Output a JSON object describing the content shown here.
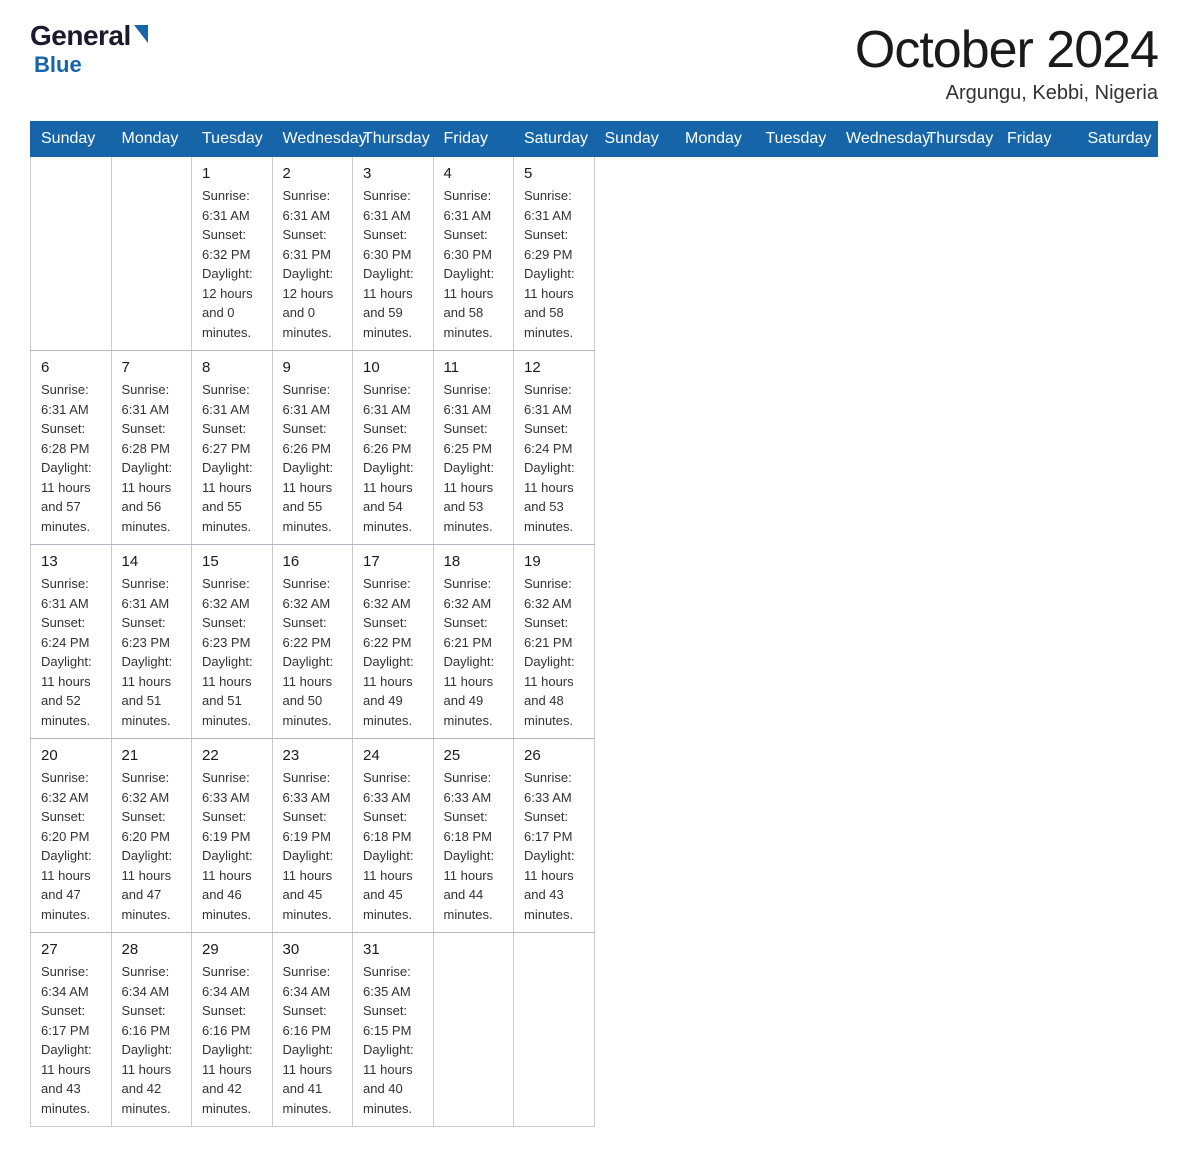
{
  "header": {
    "logo": {
      "general": "General",
      "blue": "Blue"
    },
    "title": "October 2024",
    "location": "Argungu, Kebbi, Nigeria"
  },
  "days_of_week": [
    "Sunday",
    "Monday",
    "Tuesday",
    "Wednesday",
    "Thursday",
    "Friday",
    "Saturday"
  ],
  "weeks": [
    [
      {
        "day": "",
        "info": ""
      },
      {
        "day": "",
        "info": ""
      },
      {
        "day": "1",
        "info": "Sunrise: 6:31 AM\nSunset: 6:32 PM\nDaylight: 12 hours\nand 0 minutes."
      },
      {
        "day": "2",
        "info": "Sunrise: 6:31 AM\nSunset: 6:31 PM\nDaylight: 12 hours\nand 0 minutes."
      },
      {
        "day": "3",
        "info": "Sunrise: 6:31 AM\nSunset: 6:30 PM\nDaylight: 11 hours\nand 59 minutes."
      },
      {
        "day": "4",
        "info": "Sunrise: 6:31 AM\nSunset: 6:30 PM\nDaylight: 11 hours\nand 58 minutes."
      },
      {
        "day": "5",
        "info": "Sunrise: 6:31 AM\nSunset: 6:29 PM\nDaylight: 11 hours\nand 58 minutes."
      }
    ],
    [
      {
        "day": "6",
        "info": "Sunrise: 6:31 AM\nSunset: 6:28 PM\nDaylight: 11 hours\nand 57 minutes."
      },
      {
        "day": "7",
        "info": "Sunrise: 6:31 AM\nSunset: 6:28 PM\nDaylight: 11 hours\nand 56 minutes."
      },
      {
        "day": "8",
        "info": "Sunrise: 6:31 AM\nSunset: 6:27 PM\nDaylight: 11 hours\nand 55 minutes."
      },
      {
        "day": "9",
        "info": "Sunrise: 6:31 AM\nSunset: 6:26 PM\nDaylight: 11 hours\nand 55 minutes."
      },
      {
        "day": "10",
        "info": "Sunrise: 6:31 AM\nSunset: 6:26 PM\nDaylight: 11 hours\nand 54 minutes."
      },
      {
        "day": "11",
        "info": "Sunrise: 6:31 AM\nSunset: 6:25 PM\nDaylight: 11 hours\nand 53 minutes."
      },
      {
        "day": "12",
        "info": "Sunrise: 6:31 AM\nSunset: 6:24 PM\nDaylight: 11 hours\nand 53 minutes."
      }
    ],
    [
      {
        "day": "13",
        "info": "Sunrise: 6:31 AM\nSunset: 6:24 PM\nDaylight: 11 hours\nand 52 minutes."
      },
      {
        "day": "14",
        "info": "Sunrise: 6:31 AM\nSunset: 6:23 PM\nDaylight: 11 hours\nand 51 minutes."
      },
      {
        "day": "15",
        "info": "Sunrise: 6:32 AM\nSunset: 6:23 PM\nDaylight: 11 hours\nand 51 minutes."
      },
      {
        "day": "16",
        "info": "Sunrise: 6:32 AM\nSunset: 6:22 PM\nDaylight: 11 hours\nand 50 minutes."
      },
      {
        "day": "17",
        "info": "Sunrise: 6:32 AM\nSunset: 6:22 PM\nDaylight: 11 hours\nand 49 minutes."
      },
      {
        "day": "18",
        "info": "Sunrise: 6:32 AM\nSunset: 6:21 PM\nDaylight: 11 hours\nand 49 minutes."
      },
      {
        "day": "19",
        "info": "Sunrise: 6:32 AM\nSunset: 6:21 PM\nDaylight: 11 hours\nand 48 minutes."
      }
    ],
    [
      {
        "day": "20",
        "info": "Sunrise: 6:32 AM\nSunset: 6:20 PM\nDaylight: 11 hours\nand 47 minutes."
      },
      {
        "day": "21",
        "info": "Sunrise: 6:32 AM\nSunset: 6:20 PM\nDaylight: 11 hours\nand 47 minutes."
      },
      {
        "day": "22",
        "info": "Sunrise: 6:33 AM\nSunset: 6:19 PM\nDaylight: 11 hours\nand 46 minutes."
      },
      {
        "day": "23",
        "info": "Sunrise: 6:33 AM\nSunset: 6:19 PM\nDaylight: 11 hours\nand 45 minutes."
      },
      {
        "day": "24",
        "info": "Sunrise: 6:33 AM\nSunset: 6:18 PM\nDaylight: 11 hours\nand 45 minutes."
      },
      {
        "day": "25",
        "info": "Sunrise: 6:33 AM\nSunset: 6:18 PM\nDaylight: 11 hours\nand 44 minutes."
      },
      {
        "day": "26",
        "info": "Sunrise: 6:33 AM\nSunset: 6:17 PM\nDaylight: 11 hours\nand 43 minutes."
      }
    ],
    [
      {
        "day": "27",
        "info": "Sunrise: 6:34 AM\nSunset: 6:17 PM\nDaylight: 11 hours\nand 43 minutes."
      },
      {
        "day": "28",
        "info": "Sunrise: 6:34 AM\nSunset: 6:16 PM\nDaylight: 11 hours\nand 42 minutes."
      },
      {
        "day": "29",
        "info": "Sunrise: 6:34 AM\nSunset: 6:16 PM\nDaylight: 11 hours\nand 42 minutes."
      },
      {
        "day": "30",
        "info": "Sunrise: 6:34 AM\nSunset: 6:16 PM\nDaylight: 11 hours\nand 41 minutes."
      },
      {
        "day": "31",
        "info": "Sunrise: 6:35 AM\nSunset: 6:15 PM\nDaylight: 11 hours\nand 40 minutes."
      },
      {
        "day": "",
        "info": ""
      },
      {
        "day": "",
        "info": ""
      }
    ]
  ]
}
